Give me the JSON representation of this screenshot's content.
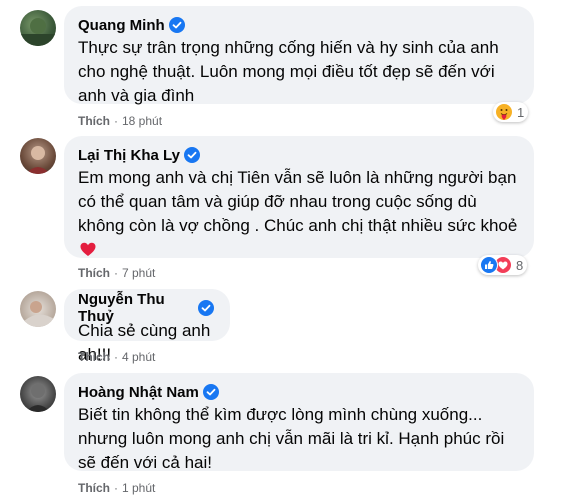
{
  "comments": [
    {
      "name": "Quang Minh",
      "text": "Thực sự trân trọng những cống hiến và hy sinh của anh cho nghệ thuật. Luôn mong mọi điều tốt đẹp sẽ đến với anh và gia đình",
      "like_label": "Thích",
      "time": "18 phút",
      "reaction_count": "1",
      "reaction_icons": [
        "care-emoji-icon"
      ]
    },
    {
      "name": "Lại Thị Kha Ly",
      "text": "Em mong anh và chị Tiên vẫn sẽ luôn là những người bạn có thể quan tâm và giúp đỡ nhau trong cuộc sống dù không còn là vợ chồng . Chúc anh chị thật nhiều sức khoẻ",
      "like_label": "Thích",
      "time": "7 phút",
      "reaction_count": "8",
      "reaction_icons": [
        "like-reaction-icon",
        "love-reaction-icon"
      ]
    },
    {
      "name": "Nguyễn Thu Thuỷ",
      "text": "Chia sẻ cùng anh ah!!!",
      "like_label": "Thích",
      "time": "4 phút"
    },
    {
      "name": "Hoàng Nhật Nam",
      "text": "Biết tin không thể kìm được lòng mình chùng xuống... nhưng luôn mong anh chị vẫn mãi là tri kỉ. Hạnh phúc rồi sẽ đến với cả hai!",
      "like_label": "Thích",
      "time": "1 phút"
    }
  ],
  "colors": {
    "bubble": "#f0f2f5",
    "verified": "#1877f2",
    "meta": "#65676b",
    "heart": "#e41e3f"
  }
}
